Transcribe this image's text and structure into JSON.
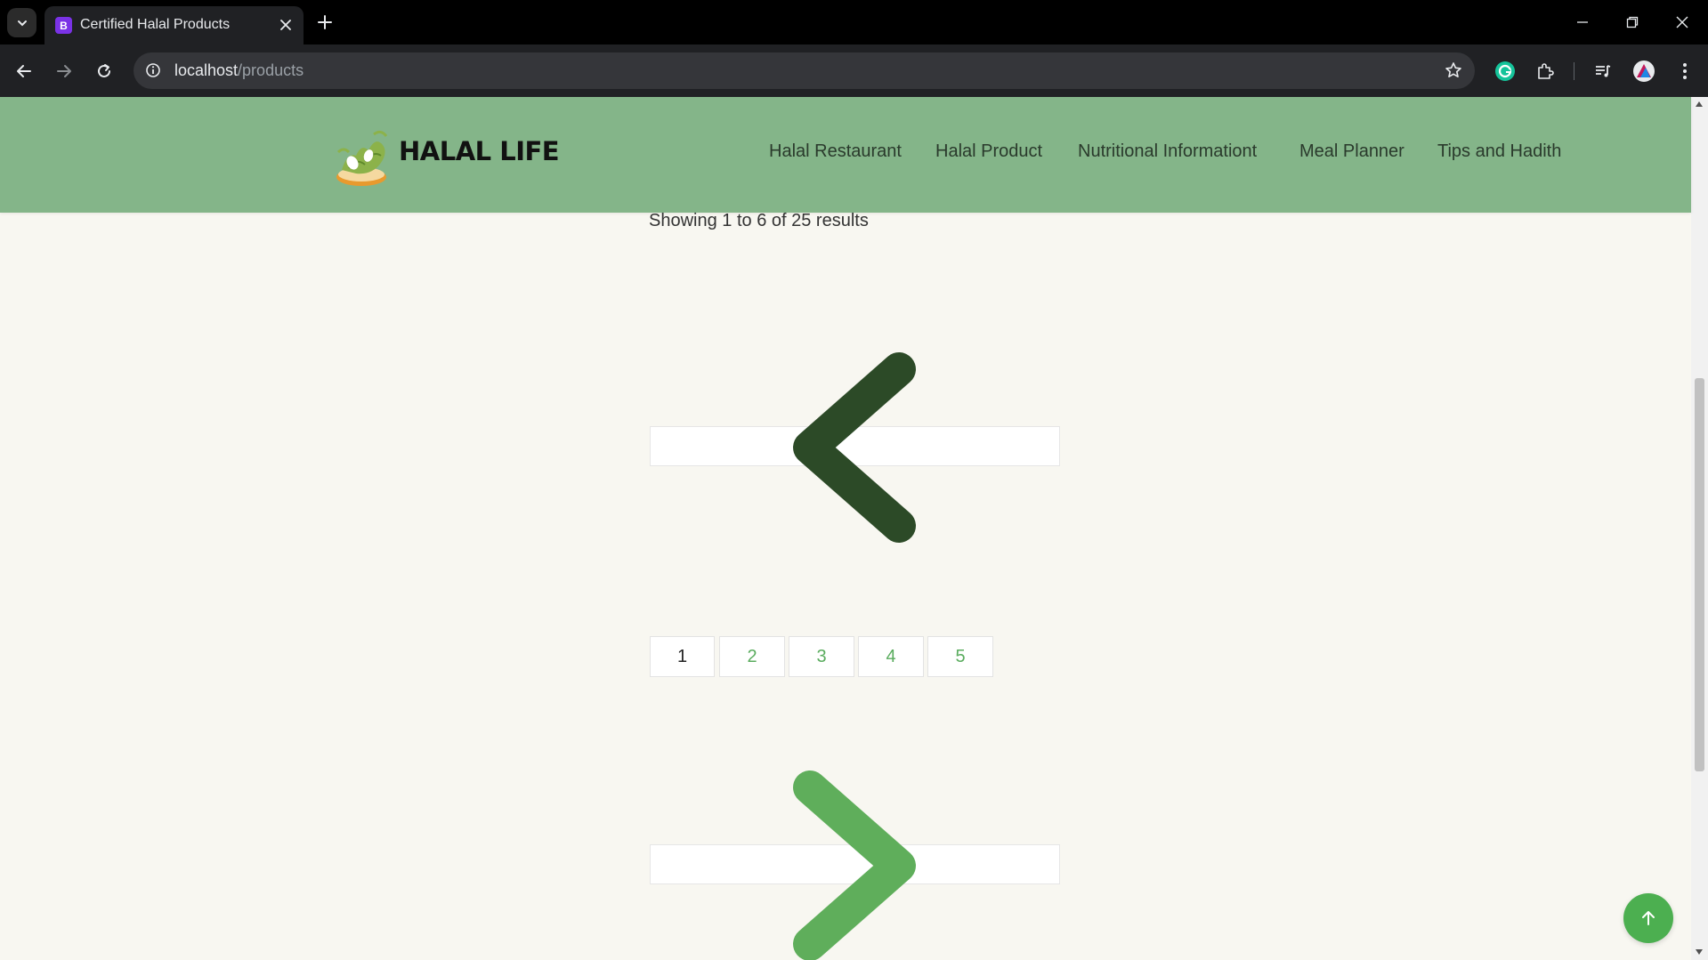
{
  "browser": {
    "tab": {
      "favicon_letter": "B",
      "title": "Certified Halal Products"
    },
    "url": {
      "host": "localhost",
      "path": "/products"
    }
  },
  "header": {
    "brand": "HALAL LIFE",
    "nav": [
      "Halal Restaurant",
      "Halal Product",
      "Nutritional Informationt",
      "Meal Planner",
      "Tips and Hadith"
    ]
  },
  "main": {
    "results_text": "Showing 1 to 6 of 25 results",
    "pagination": {
      "current": "1",
      "pages": [
        "1",
        "2",
        "3",
        "4",
        "5"
      ]
    }
  },
  "colors": {
    "header_bg": "#84b589",
    "prev_chevron": "#2c4a27",
    "next_chevron": "#5fae5b",
    "link_green": "#5aac5e",
    "to_top_button": "#4caf50"
  },
  "icons": {
    "prev": "chevron-left-icon",
    "next": "chevron-right-icon",
    "back_to_top": "arrow-up-icon"
  }
}
